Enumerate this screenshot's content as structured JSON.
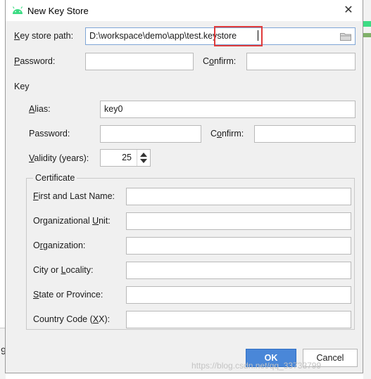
{
  "window": {
    "title": "New Key Store",
    "close_icon": "close-icon",
    "app_icon": "android-icon"
  },
  "key_store_path": {
    "label": "Key store path:",
    "value": "D:\\workspace\\demo\\app\\test.keystore",
    "browse_icon": "folder-icon"
  },
  "store_password": {
    "label": "Password:",
    "value": ""
  },
  "store_confirm": {
    "label": "Confirm:",
    "value": ""
  },
  "key_section": {
    "title": "Key"
  },
  "alias": {
    "label": "Alias:",
    "value": "key0"
  },
  "key_password": {
    "label": "Password:",
    "value": ""
  },
  "key_confirm": {
    "label": "Confirm:",
    "value": ""
  },
  "validity": {
    "label": "Validity (years):",
    "value": "25"
  },
  "certificate": {
    "title": "Certificate",
    "fields": [
      {
        "label": "First and Last Name:",
        "value": ""
      },
      {
        "label": "Organizational Unit:",
        "value": ""
      },
      {
        "label": "Organization:",
        "value": ""
      },
      {
        "label": "City or Locality:",
        "value": ""
      },
      {
        "label": "State or Province:",
        "value": ""
      },
      {
        "label": "Country Code (XX):",
        "value": ""
      }
    ]
  },
  "buttons": {
    "ok": "OK",
    "cancel": "Cancel"
  },
  "background": {
    "bottom_char": "9"
  },
  "watermark": "https://blog.csdn.net/qq_33733799",
  "colors": {
    "accent": "#4a87d8",
    "highlight": "#e03b3b",
    "android_green": "#3ddc84"
  }
}
